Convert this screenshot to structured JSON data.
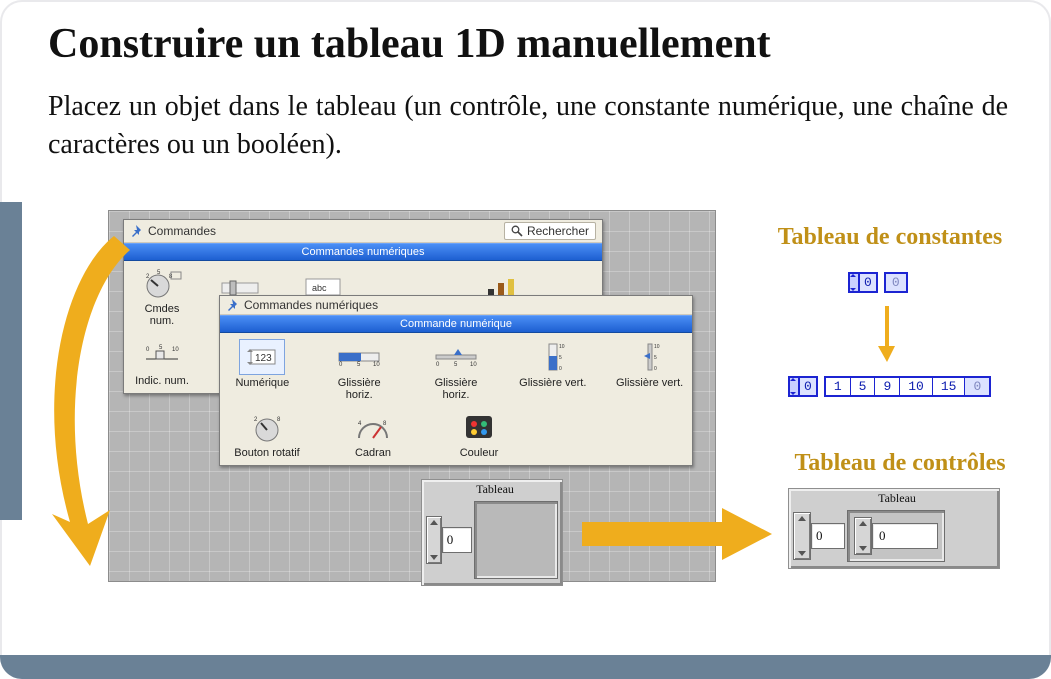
{
  "title": "Construire un tableau 1D manuellement",
  "description": "Placez un objet dans le tableau (un contrôle, une constante numérique, une chaîne de caractères ou un booléen).",
  "palettes": {
    "commands": {
      "title": "Commandes",
      "search": "Rechercher",
      "subtitle": "Commandes numériques",
      "left": [
        "Cmdes num.",
        "Indic. num."
      ]
    },
    "numeric": {
      "title": "Commandes numériques",
      "subtitle": "Commande numérique",
      "items": [
        "Numérique",
        "Glissière horiz.",
        "Glissière horiz.",
        "Glissière vert.",
        "Glissière vert.",
        "Bouton rotatif",
        "Cadran",
        "Couleur"
      ]
    }
  },
  "right": {
    "constants_header": "Tableau de constantes",
    "controls_header": "Tableau de contrôles"
  },
  "arrays": {
    "empty": {
      "caption": "Tableau",
      "index": "0"
    },
    "const_single": {
      "index": "0",
      "value": "0"
    },
    "const_filled": {
      "index": "0",
      "values": [
        "1",
        "5",
        "9",
        "10",
        "15",
        "0"
      ]
    },
    "ctrl": {
      "caption": "Tableau",
      "index": "0",
      "value": "0"
    }
  },
  "colors": {
    "accent_orange": "#efad1d",
    "accent_header": "#c09018",
    "accent_side": "#6a8196",
    "blue": "#1c24d2"
  }
}
